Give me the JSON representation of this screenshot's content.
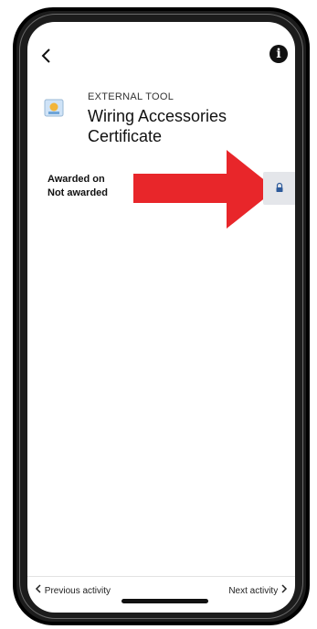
{
  "header": {
    "back_icon": "chevron-left-icon",
    "info_icon": "info-icon",
    "info_glyph": "i"
  },
  "activity": {
    "icon": "certificate-icon",
    "type_label": "EXTERNAL TOOL",
    "title": "Wiring Accessories Certificate"
  },
  "award": {
    "label": "Awarded on",
    "status": "Not awarded"
  },
  "annotation": {
    "arrow_color": "#e8262a"
  },
  "lock_button": {
    "icon": "lock-icon",
    "background": "#e4e6ea"
  },
  "footer": {
    "prev_label": "Previous activity",
    "next_label": "Next activity"
  }
}
